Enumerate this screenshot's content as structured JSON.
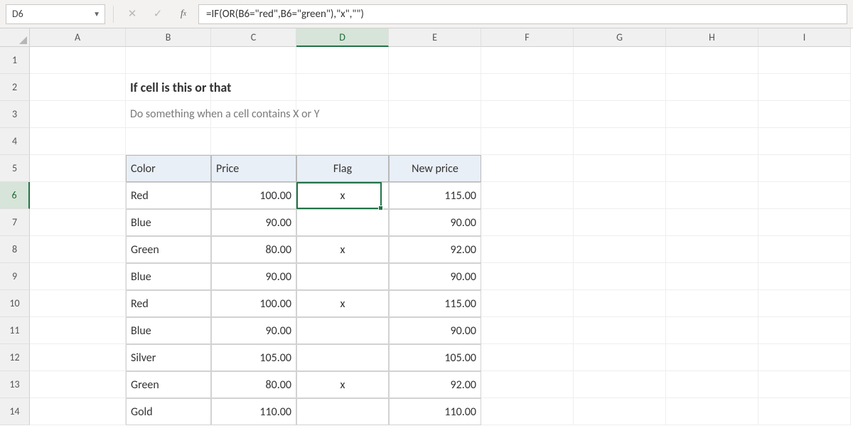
{
  "namebox": {
    "value": "D6"
  },
  "formula": "=IF(OR(B6=\"red\",B6=\"green\"),\"x\",\"\")",
  "columns": [
    "A",
    "B",
    "C",
    "D",
    "E",
    "F",
    "G",
    "H",
    "I"
  ],
  "rows": [
    "1",
    "2",
    "3",
    "4",
    "5",
    "6",
    "7",
    "8",
    "9",
    "10",
    "11",
    "12",
    "13",
    "14"
  ],
  "title": "If cell is this or that",
  "subtitle": "Do something when a cell contains X or Y",
  "headers": {
    "color": "Color",
    "price": "Price",
    "flag": "Flag",
    "newprice": "New price"
  },
  "data": [
    {
      "color": "Red",
      "price": "100.00",
      "flag": "x",
      "newprice": "115.00"
    },
    {
      "color": "Blue",
      "price": "90.00",
      "flag": "",
      "newprice": "90.00"
    },
    {
      "color": "Green",
      "price": "80.00",
      "flag": "x",
      "newprice": "92.00"
    },
    {
      "color": "Blue",
      "price": "90.00",
      "flag": "",
      "newprice": "90.00"
    },
    {
      "color": "Red",
      "price": "100.00",
      "flag": "x",
      "newprice": "115.00"
    },
    {
      "color": "Blue",
      "price": "90.00",
      "flag": "",
      "newprice": "90.00"
    },
    {
      "color": "Silver",
      "price": "105.00",
      "flag": "",
      "newprice": "105.00"
    },
    {
      "color": "Green",
      "price": "80.00",
      "flag": "x",
      "newprice": "92.00"
    },
    {
      "color": "Gold",
      "price": "110.00",
      "flag": "",
      "newprice": "110.00"
    }
  ],
  "selected": {
    "col": "D",
    "row": "6"
  }
}
